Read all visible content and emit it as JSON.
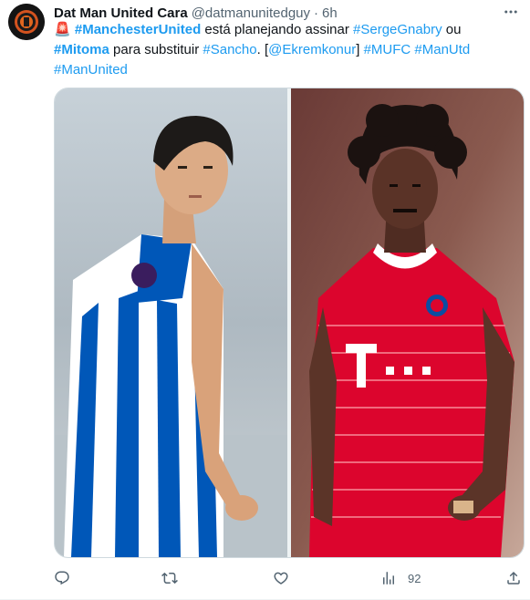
{
  "tweet": {
    "author_name": "Dat Man United Cara",
    "handle": "@datmanunitedguy",
    "separator": "·",
    "time": "6h",
    "text_parts": [
      {
        "text": "🚨 ",
        "kind": "plain"
      },
      {
        "text": "#ManchesterUnited",
        "kind": "tag-bold"
      },
      {
        "text": " está planejando assinar ",
        "kind": "plain"
      },
      {
        "text": "#SergeGnabry",
        "kind": "tag"
      },
      {
        "text": " ou ",
        "kind": "plain"
      },
      {
        "text": "#Mitoma",
        "kind": "tag-bold"
      },
      {
        "text": " para substituir ",
        "kind": "plain"
      },
      {
        "text": "#Sancho",
        "kind": "tag"
      },
      {
        "text": ". [",
        "kind": "plain"
      },
      {
        "text": "@Ekremkonur",
        "kind": "tag"
      },
      {
        "text": "]  ",
        "kind": "plain"
      },
      {
        "text": "#MUFC",
        "kind": "tag"
      },
      {
        "text": " ",
        "kind": "plain"
      },
      {
        "text": "#ManUtd",
        "kind": "tag"
      },
      {
        "text": " ",
        "kind": "plain"
      },
      {
        "text": "#ManUnited",
        "kind": "tag"
      }
    ],
    "views_count": "92"
  },
  "icons": {
    "more": "more-icon",
    "reply": "reply-icon",
    "retweet": "retweet-icon",
    "like": "like-icon",
    "views": "views-icon",
    "share": "share-icon"
  },
  "colors": {
    "link": "#1d9bf0",
    "secondary_text": "#536471",
    "border": "#cfd9de",
    "brighton_blue": "#0057b8",
    "bayern_red": "#dc052d"
  }
}
